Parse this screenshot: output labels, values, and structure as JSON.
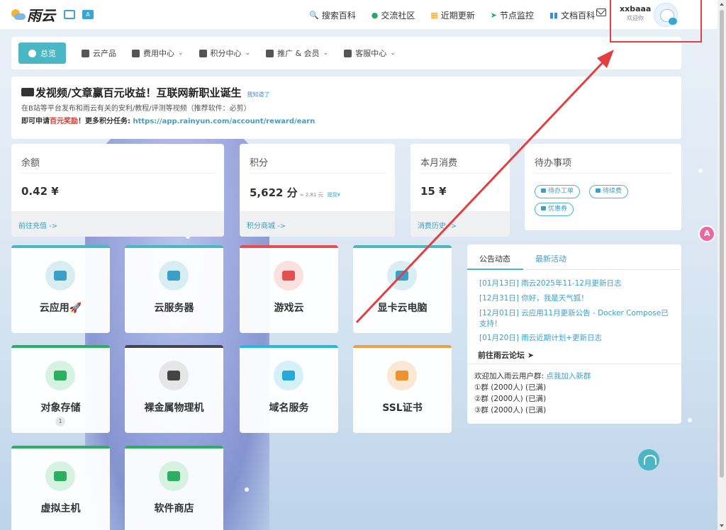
{
  "topbar": {
    "brand": "雨云",
    "links": [
      {
        "icon": "search-icon",
        "glyph": "🔍",
        "label": "搜索百科",
        "color": "#333"
      },
      {
        "icon": "chat-icon",
        "glyph": "●",
        "label": "交流社区",
        "color": "#2aa860"
      },
      {
        "icon": "calendar-icon",
        "glyph": "▦",
        "label": "近期更新",
        "color": "#f0a020"
      },
      {
        "icon": "send-icon",
        "glyph": "➤",
        "label": "节点监控",
        "color": "#2aa860"
      },
      {
        "icon": "book-icon",
        "glyph": "▮▮",
        "label": "文档百科",
        "color": "#3a8fd0"
      }
    ],
    "username": "xxbaaa",
    "welcome": "欢迎你"
  },
  "mainnav": {
    "items": [
      {
        "label": "总览",
        "icon": "dashboard-icon",
        "active": true,
        "dropdown": false
      },
      {
        "label": "云产品",
        "icon": "cubes-icon",
        "active": false,
        "dropdown": false
      },
      {
        "label": "费用中心",
        "icon": "money-icon",
        "active": false,
        "dropdown": true
      },
      {
        "label": "积分中心",
        "icon": "gift-icon",
        "active": false,
        "dropdown": true
      },
      {
        "label": "推广 & 会员",
        "icon": "users-icon",
        "active": false,
        "dropdown": true
      },
      {
        "label": "客服中心",
        "icon": "headset-icon",
        "active": false,
        "dropdown": true
      }
    ]
  },
  "announce": {
    "title": "发视频/文章赢百元收益！互联网新职业诞生",
    "dismiss": "我知道了",
    "line1": "在B站等平台发布和雨云有关的安利/教程/评测等视频（推荐软件：必剪）",
    "line2_prefix": "即可申请",
    "line2_red": "百元奖励",
    "line2_mid": "！更多积分任务: ",
    "line2_link": "https://app.rainyun.com/account/reward/earn"
  },
  "stats": {
    "balance": {
      "label": "余额",
      "value": "0.42 ¥",
      "footer": "前往充值 ->"
    },
    "points": {
      "label": "积分",
      "value": "5,622 分",
      "approx": "≈ 2.81 元",
      "withdraw": "提现¥",
      "footer": "积分商城 ->"
    },
    "monthly": {
      "label": "本月消费",
      "value": "15 ¥",
      "footer": "消费历史 ->"
    },
    "todo": {
      "label": "待办事项",
      "buttons": [
        "待办工单",
        "待续费",
        "优惠券"
      ]
    }
  },
  "tiles": [
    {
      "name": "云应用",
      "extra": "🚀",
      "color": "#4bb6c4",
      "icon": "cloud-icon",
      "circle": "#d8eef2",
      "mark": "#3aa0c8"
    },
    {
      "name": "云服务器",
      "extra": "",
      "color": "#4bb6c4",
      "icon": "box-icon",
      "circle": "#d8eef2",
      "mark": "#3aa0c8"
    },
    {
      "name": "游戏云",
      "extra": "",
      "color": "#e25050",
      "icon": "gamepad-icon",
      "circle": "#fbe0e0",
      "mark": "#e25050"
    },
    {
      "name": "显卡云电脑",
      "extra": "",
      "color": "#4bb6c4",
      "icon": "monitor-icon",
      "circle": "#d8eef2",
      "mark": "#3aa0c8"
    },
    {
      "name": "对象存储",
      "extra": "",
      "badge": "1",
      "color": "#2ab060",
      "icon": "database-icon",
      "circle": "#d6f2e0",
      "mark": "#2ab060"
    },
    {
      "name": "裸金属物理机",
      "extra": "",
      "color": "#444444",
      "icon": "server-icon",
      "circle": "#e6e6e6",
      "mark": "#444444"
    },
    {
      "name": "域名服务",
      "extra": "",
      "color": "#26b8e0",
      "icon": "globe-icon",
      "circle": "#d6f0f8",
      "mark": "#26a8d8"
    },
    {
      "name": "SSL证书",
      "extra": "",
      "color": "#f0a040",
      "icon": "key-icon",
      "circle": "#fbe8d4",
      "mark": "#f09030"
    },
    {
      "name": "虚拟主机",
      "extra": "",
      "color": "#2ab060",
      "icon": "host-icon",
      "circle": "#d6f2e0",
      "mark": "#2ab060"
    },
    {
      "name": "软件商店",
      "extra": "",
      "color": "#2ab060",
      "icon": "cart-icon",
      "circle": "#d6f2e0",
      "mark": "#2ab060"
    }
  ],
  "news": {
    "tab_active": "公告动态",
    "tab_other": "最新活动",
    "items": [
      "[01月13日] 雨云2025年11-12月更新日志",
      "[12月31日] 你好，我是天气狐！",
      "[12月01日] 云应用11月更新公告 - Docker Compose已支持！",
      "[01月20日] 雨云近期计划+更新日志"
    ],
    "forum": "前往雨云论坛",
    "group_intro": "欢迎加入雨云用户群: ",
    "group_link": "点我加入新群",
    "groups": [
      "①群 (2000人) (已满)",
      "②群 (2000人) (已满)",
      "③群 (2000人) (已满)"
    ]
  },
  "colors": {
    "accent": "#4bb6c4",
    "link": "#3aa0c8",
    "annotation": "#e24040"
  }
}
